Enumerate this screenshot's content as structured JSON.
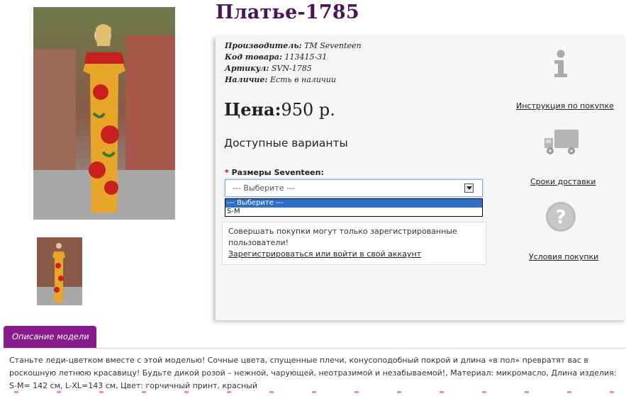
{
  "product": {
    "title": "Платье-1785",
    "manufacturer_label": "Производитель:",
    "manufacturer_value": "TM Seventeen",
    "code_label": "Код товара:",
    "code_value": "113415-31",
    "sku_label": "Артикул:",
    "sku_value": "SVN-1785",
    "stock_label": "Наличие:",
    "stock_value": "Есть в наличии",
    "price_label": "Цена:",
    "price_value": "950 р.",
    "variants_heading": "Доступные варианты"
  },
  "options": {
    "required_mark": "*",
    "size_label": "Размеры Seventeen:",
    "selected": "--- Выберите ---",
    "list": [
      "--- Выберите ---",
      "S-M"
    ]
  },
  "notice": {
    "text": "Совершать покупки могут только зарегистрированные пользователи!",
    "link": "Зарегистрироваться или войти в свой аккаунт"
  },
  "sidebar": {
    "instruction": "Инструкция по покупке",
    "delivery": "Сроки доставки",
    "terms": "Условия покупки"
  },
  "tabs": {
    "description": "Описание модели"
  },
  "description": {
    "text": "Станьте леди-цветком вместе с этой моделью! Сочные цвета, спущенные плечи, конусоподобный покрой и длина «в пол» превратят вас в роскошную летнюю красавицу! Будьте дикой розой – нежной, чарующей, неотразимой и незабываемой!, Материал: микромасло, Длина изделия: S-M= 142 см, L-XL=143 см, Цвет: горчичный принт, красный"
  },
  "colors": {
    "title": "#4a1458",
    "tab": "#8a1a8c",
    "dress": "#e7a52a",
    "rose": "#c8201e"
  }
}
